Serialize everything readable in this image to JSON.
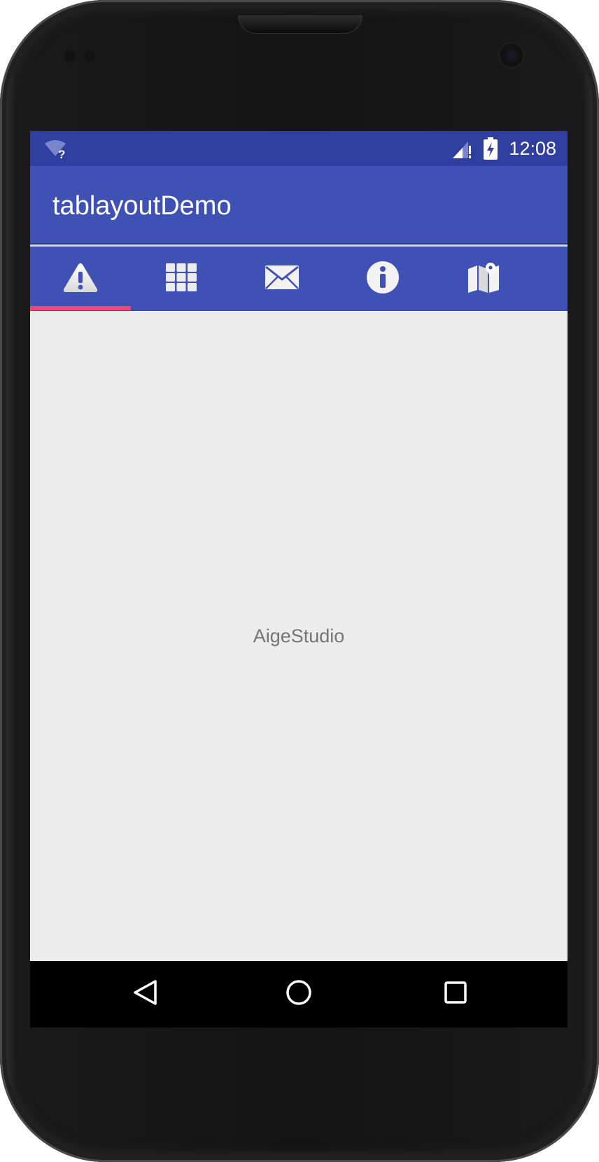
{
  "status_bar": {
    "time": "12:08",
    "icons": [
      "wifi-unknown-icon",
      "signal-no-data-icon",
      "battery-charging-icon"
    ]
  },
  "app_bar": {
    "title": "tablayoutDemo"
  },
  "tabs": [
    {
      "icon": "warning-icon",
      "selected": true
    },
    {
      "icon": "grid-icon",
      "selected": false
    },
    {
      "icon": "mail-icon",
      "selected": false
    },
    {
      "icon": "info-icon",
      "selected": false
    },
    {
      "icon": "map-icon",
      "selected": false
    }
  ],
  "content": {
    "text": "AigeStudio"
  },
  "nav_bar": {
    "buttons": [
      "back-icon",
      "home-icon",
      "recents-icon"
    ]
  },
  "colors": {
    "primary": "#3f51b5",
    "primary_dark": "#303f9f",
    "accent": "#ff4081",
    "background": "#ececec"
  }
}
